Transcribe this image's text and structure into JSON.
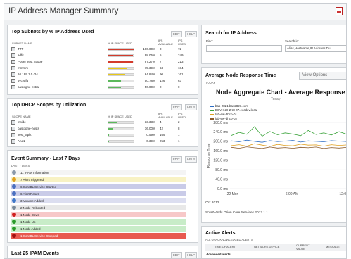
{
  "page": {
    "title": "IP Address Manager Summary",
    "export_icon": "pdf-icon"
  },
  "subnets": {
    "title": "Top Subnets by % IP Address Used",
    "edit": "EDIT",
    "help": "HELP",
    "columns": [
      "SUBNET NAME",
      "% IP SPACE USED",
      "IPS AVAILABLE",
      "IPS USED"
    ],
    "rows": [
      {
        "name": "TTT",
        "pct_label": "100.00%",
        "pct": 100.0,
        "available": "0",
        "used": "72",
        "color": "#d33b2c"
      },
      {
        "name": "adfv",
        "pct_label": "98.05%",
        "pct": 98.05,
        "available": "5",
        "used": "249",
        "color": "#d33b2c"
      },
      {
        "name": "Potter Test Scope",
        "pct_label": "97.27%",
        "pct": 97.27,
        "available": "7",
        "used": "213",
        "color": "#d33b2c"
      },
      {
        "name": "mmmm",
        "pct_label": "75.39%",
        "pct": 75.39,
        "available": "63",
        "used": "184",
        "color": "#e8c818"
      },
      {
        "name": "10.199.1.0 /24",
        "pct_label": "64.84%",
        "pct": 64.84,
        "available": "90",
        "used": "161",
        "color": "#e8c818"
      },
      {
        "name": "svcvdfg",
        "pct_label": "50.78%",
        "pct": 50.78,
        "available": "126",
        "used": "63",
        "color": "#5cb85c"
      },
      {
        "name": "bastogne-extra",
        "pct_label": "50.00%",
        "pct": 50.0,
        "available": "2",
        "used": "0",
        "color": "#5cb85c"
      }
    ]
  },
  "dhcp": {
    "title": "Top DHCP Scopes by Utilization",
    "edit": "EDIT",
    "help": "HELP",
    "columns": [
      "SCOPE NAME",
      "% IP SPACE USED",
      "IPS AVAILABLE",
      "IPS USED"
    ],
    "rows": [
      {
        "name": "inside",
        "pct_label": "33.33%",
        "pct": 33.33,
        "available": "4",
        "used": "2",
        "color": "#5cb85c"
      },
      {
        "name": "bastogne-hosts",
        "pct_label": "16.00%",
        "pct": 16.0,
        "available": "42",
        "used": "8",
        "color": "#5cb85c"
      },
      {
        "name": "Test_Split",
        "pct_label": "0.59%",
        "pct": 0.59,
        "available": "169",
        "used": "1",
        "color": "#5cb85c"
      },
      {
        "name": "And1",
        "pct_label": "0.39%",
        "pct": 0.39,
        "available": "253",
        "used": "1",
        "color": "#5cb85c"
      }
    ]
  },
  "events": {
    "title": "Event Summary - Last 7 Days",
    "subtitle": "LAST 7 DAYS",
    "edit": "EDIT",
    "help": "HELP",
    "rows": [
      {
        "text": "11 IPAM Information",
        "bg": "#f4f4f4",
        "icon": "#8a99aa"
      },
      {
        "text": "7 Alert Triggered",
        "bg": "#f8f2c4",
        "icon": "#e0a020"
      },
      {
        "text": "6 CoreBL Service Started",
        "bg": "#c9cbe8",
        "icon": "#4a6fc0"
      },
      {
        "text": "6 Alert Reset",
        "bg": "#c9cbe8",
        "icon": "#4a6fc0"
      },
      {
        "text": "3 Volume Added",
        "bg": "#dcdef0",
        "icon": "#3f78c8"
      },
      {
        "text": "2 Node Rebooted",
        "bg": "#e8e8e8",
        "icon": "#7a8a9a"
      },
      {
        "text": "1 Node Down",
        "bg": "#f7c8c8",
        "icon": "#d02020"
      },
      {
        "text": "1 Node Up",
        "bg": "#c8ecc8",
        "icon": "#2a9a2a"
      },
      {
        "text": "1 Node Added",
        "bg": "#c8ecc8",
        "icon": "#2a9a2a"
      },
      {
        "text": "1 CoreBL Service Stopped",
        "bg": "#e85a50",
        "icon": "#a01010"
      }
    ]
  },
  "ipam_events": {
    "title": "Last 25 IPAM Events",
    "edit": "EDIT",
    "help": "HELP"
  },
  "search": {
    "title": "Search for IP Address",
    "find_label": "Find:",
    "find_value": "",
    "search_in_label": "Search in:",
    "search_in_value": "Alias,Hostname,IP Address,Du"
  },
  "response": {
    "title": "Average Node Response Time",
    "subtitle": "TODAY",
    "view_options": "View Options",
    "chart_title": "Node Aggregate Chart - Average Response",
    "chart_subtitle": "Today",
    "footer": "SolarWinds Orion Core Services 2012.1.1"
  },
  "chart_data": {
    "type": "line",
    "title": "Node Aggregate Chart - Average Response",
    "subtitle": "Today",
    "ylabel": "Response Time",
    "yticks": [
      "280.0 ms",
      "240.0 ms",
      "200.0 ms",
      "160.0 ms",
      "120.0 ms",
      "80.0 ms",
      "40.0 ms",
      "0.0 ms"
    ],
    "ylim": [
      0,
      280
    ],
    "xticks": [
      "22 Mon",
      "6:00 AM",
      "12:00 P"
    ],
    "xlabel_date": "Oct 2012",
    "series": [
      {
        "name": "bas-2821.bas2821.com",
        "color": "#2b6cc4",
        "values": [
          202,
          198,
          205,
          200,
          196,
          203,
          199,
          201,
          204,
          197,
          202,
          200,
          198,
          203,
          201,
          199
        ]
      },
      {
        "name": "DEV-IND-2K8-07.eccdev.local",
        "color": "#3aa33a",
        "values": [
          225,
          238,
          230,
          262,
          222,
          242,
          228,
          236,
          231,
          224,
          246,
          229,
          236,
          227,
          241,
          230
        ]
      },
      {
        "name": "lab-ew-dhcp-01",
        "color": "#e0a020",
        "values": [
          182,
          186,
          180,
          190,
          184,
          179,
          187,
          183,
          181,
          188,
          184,
          185,
          180,
          186,
          183,
          185
        ]
      },
      {
        "name": "lab-ew-dhcp-02",
        "color": "#8b5a2b",
        "values": [
          175,
          171,
          177,
          173,
          170,
          176,
          172,
          174,
          171,
          175,
          173,
          176,
          170,
          174,
          172,
          175
        ]
      }
    ]
  },
  "alerts": {
    "title": "Active Alerts",
    "subtitle": "ALL UNACKNOWLEDGED ALERTS",
    "columns": [
      "TIME OF ALERT",
      "NETWORK DEVICE",
      "CURRENT VALUE",
      "MESSAGE"
    ],
    "section": "Advanced alerts"
  }
}
